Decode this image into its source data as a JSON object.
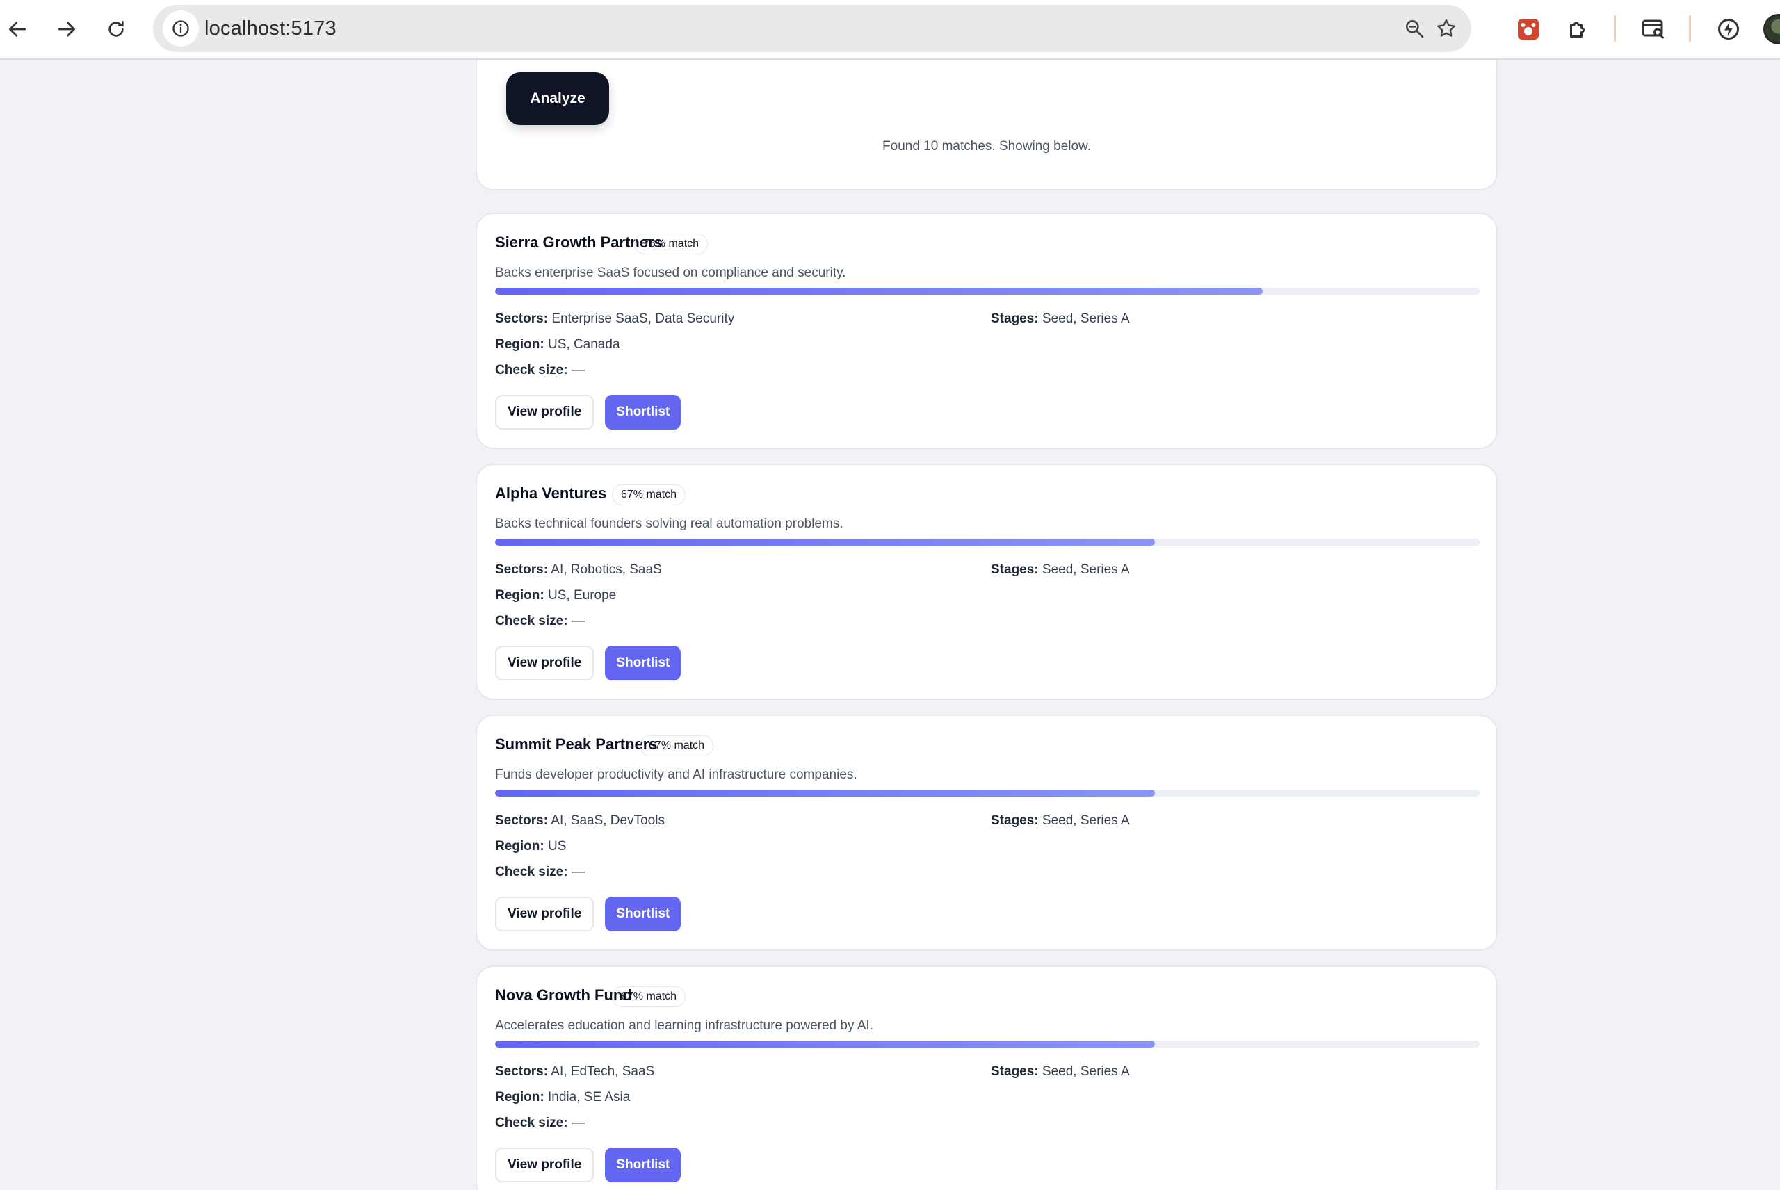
{
  "browser": {
    "url": "localhost:5173",
    "colors": {
      "toolbar_bg": "#ffffff",
      "omnibox_bg": "#e9e9ea"
    }
  },
  "analyze": {
    "button_label": "Analyze",
    "status": "Found 10 matches. Showing below."
  },
  "labels": {
    "sectors": "Sectors:",
    "stages": "Stages:",
    "region": "Region:",
    "check_size": "Check size:",
    "view_profile": "View profile",
    "shortlist": "Shortlist"
  },
  "matches": [
    {
      "name": "Sierra Growth Partners",
      "badge": "78% match",
      "match_fraction": 0.78,
      "description": "Backs enterprise SaaS focused on compliance and security.",
      "sectors": "Enterprise SaaS, Data Security",
      "stages": "Seed, Series A",
      "region": "US, Canada",
      "check_size": "—"
    },
    {
      "name": "Alpha Ventures",
      "badge": "67% match",
      "match_fraction": 0.67,
      "description": "Backs technical founders solving real automation problems.",
      "sectors": "AI, Robotics, SaaS",
      "stages": "Seed, Series A",
      "region": "US, Europe",
      "check_size": "—"
    },
    {
      "name": "Summit Peak Partners",
      "badge": "67% match",
      "match_fraction": 0.67,
      "description": "Funds developer productivity and AI infrastructure companies.",
      "sectors": "AI, SaaS, DevTools",
      "stages": "Seed, Series A",
      "region": "US",
      "check_size": "—"
    },
    {
      "name": "Nova Growth Fund",
      "badge": "67% match",
      "match_fraction": 0.67,
      "description": "Accelerates education and learning infrastructure powered by AI.",
      "sectors": "AI, EdTech, SaaS",
      "stages": "Seed, Series A",
      "region": "India, SE Asia",
      "check_size": "—"
    }
  ],
  "theme": {
    "accent": "#6366f1",
    "dark_button": "#0f1524",
    "page_bg": "#f2f1f6"
  }
}
